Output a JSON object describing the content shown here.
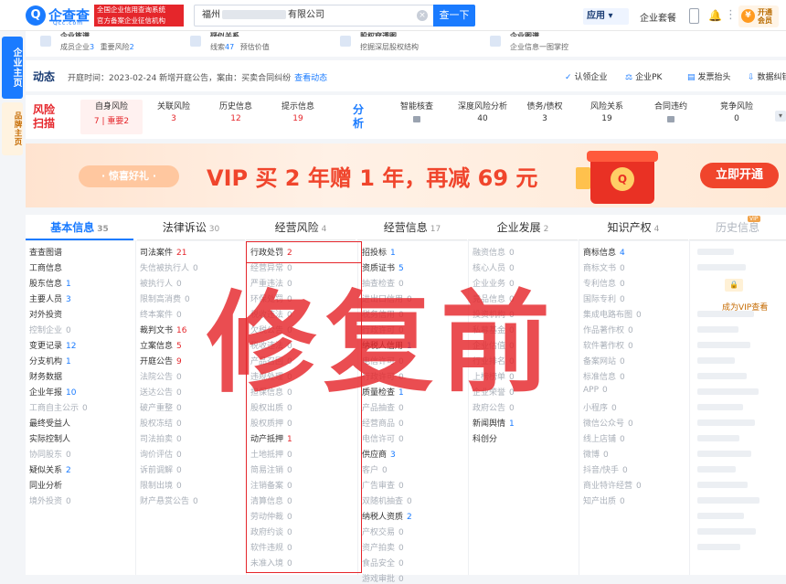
{
  "header": {
    "logo_icon": "Q",
    "logo_text": "企查查",
    "logo_sub": "Qcc.com",
    "tag_line1": "全国企业信用查询系统",
    "tag_line2": "官方备案企业征信机构",
    "search_prefix": "福州",
    "search_suffix": "有限公司",
    "search_button": "查一下",
    "app_label": "应用 ▾",
    "enterprise_link": "企业套餐",
    "vip_badge": "¥",
    "vip_line1": "开通",
    "vip_line2": "会员"
  },
  "sidebar": {
    "enterprise_home": "企业主页",
    "brand_home": "品牌主页"
  },
  "summary_cards": [
    {
      "title": "企业族谱",
      "sub_label1": "成员企业",
      "sub_value1": "3",
      "sub_label2": "重要风险",
      "sub_value2": "2"
    },
    {
      "title": "疑似关系",
      "sub_label1": "线索",
      "sub_value1": "47",
      "sub_label2": "预估价值",
      "sub_value2": ""
    },
    {
      "title": "股权穿透图",
      "sub_label1": "挖掘深层股权结构",
      "sub_value1": "",
      "sub_label2": "",
      "sub_value2": ""
    },
    {
      "title": "企业图谱",
      "sub_label1": "企业信息一图掌控",
      "sub_value1": "",
      "sub_label2": "",
      "sub_value2": ""
    }
  ],
  "dynamics": {
    "title": "动态",
    "text": "开庭时间：2023-02-24 新增开庭公告，案由：买卖合同纠纷",
    "link": "查看动态",
    "actions": [
      {
        "icon": "✓",
        "label": "认领企业"
      },
      {
        "icon": "⚖",
        "label": "企业PK"
      },
      {
        "icon": "▤",
        "label": "发票抬头"
      },
      {
        "icon": "⇩",
        "label": "数据纠错"
      }
    ]
  },
  "risk": {
    "label_line1": "风险",
    "label_line2": "扫描",
    "items": [
      {
        "title": "自身风险",
        "count": "7",
        "important_label": "重要2"
      },
      {
        "title": "关联风险",
        "count": "3"
      },
      {
        "title": "历史信息",
        "count": "12"
      },
      {
        "title": "提示信息",
        "count": "19"
      }
    ]
  },
  "analysis": {
    "label_line1": "分",
    "label_line2": "析",
    "items": [
      {
        "title": "智能核查",
        "count": ""
      },
      {
        "title": "深度风险分析",
        "count": "40"
      },
      {
        "title": "债务/债权",
        "count": "3"
      },
      {
        "title": "风险关系",
        "count": "19"
      },
      {
        "title": "合同违约",
        "count": ""
      },
      {
        "title": "竞争风险",
        "count": "0"
      }
    ],
    "expand": "▾"
  },
  "banner": {
    "tag": "· 惊喜好礼 ·",
    "text": "VIP 买 2 年赠 1 年，再减 69 元",
    "coin": "Q",
    "button": "立即开通"
  },
  "tabs": [
    {
      "label": "基本信息",
      "count": "35"
    },
    {
      "label": "法律诉讼",
      "count": "30"
    },
    {
      "label": "经营风险",
      "count": "4"
    },
    {
      "label": "经营信息",
      "count": "17"
    },
    {
      "label": "企业发展",
      "count": "2"
    },
    {
      "label": "知识产权",
      "count": "4"
    },
    {
      "label": "历史信息",
      "count": ""
    }
  ],
  "vip_mini": "VIP",
  "columns": {
    "basic": [
      {
        "label": "查查图谱",
        "value": ""
      },
      {
        "label": "工商信息",
        "value": ""
      },
      {
        "label": "股东信息",
        "value": "1"
      },
      {
        "label": "主要人员",
        "value": "3"
      },
      {
        "label": "对外投资",
        "value": ""
      },
      {
        "label": "控制企业",
        "value": "0"
      },
      {
        "label": "变更记录",
        "value": "12"
      },
      {
        "label": "分支机构",
        "value": "1"
      },
      {
        "label": "财务数据",
        "value": ""
      },
      {
        "label": "企业年报",
        "value": "10"
      },
      {
        "label": "工商自主公示",
        "value": "0"
      },
      {
        "label": "最终受益人",
        "value": ""
      },
      {
        "label": "实际控制人",
        "value": ""
      },
      {
        "label": "协同股东",
        "value": "0"
      },
      {
        "label": "疑似关系",
        "value": "2"
      },
      {
        "label": "同业分析",
        "value": ""
      },
      {
        "label": "境外投资",
        "value": "0"
      }
    ],
    "legal": [
      {
        "label": "司法案件",
        "value": "21"
      },
      {
        "label": "失信被执行人",
        "value": "0"
      },
      {
        "label": "被执行人",
        "value": "0"
      },
      {
        "label": "限制高消费",
        "value": "0"
      },
      {
        "label": "终本案件",
        "value": "0"
      },
      {
        "label": "裁判文书",
        "value": "16"
      },
      {
        "label": "立案信息",
        "value": "5"
      },
      {
        "label": "开庭公告",
        "value": "9"
      },
      {
        "label": "法院公告",
        "value": "0"
      },
      {
        "label": "送达公告",
        "value": "0"
      },
      {
        "label": "破产重整",
        "value": "0"
      },
      {
        "label": "股权冻结",
        "value": "0"
      },
      {
        "label": "司法拍卖",
        "value": "0"
      },
      {
        "label": "询价评估",
        "value": "0"
      },
      {
        "label": "诉前调解",
        "value": "0"
      },
      {
        "label": "限制出境",
        "value": "0"
      },
      {
        "label": "财产悬赏公告",
        "value": "0"
      }
    ],
    "risk": [
      {
        "label": "行政处罚",
        "value": "2"
      },
      {
        "label": "经营异常",
        "value": "0"
      },
      {
        "label": "严重违法",
        "value": "0"
      },
      {
        "label": "环保处罚",
        "value": "0"
      },
      {
        "label": "税收违法",
        "value": "0"
      },
      {
        "label": "欠税公告",
        "value": "0"
      },
      {
        "label": "税收违法",
        "value": "0"
      },
      {
        "label": "产品召回",
        "value": "0"
      },
      {
        "label": "违规处理",
        "value": "0"
      },
      {
        "label": "担保信息",
        "value": "0"
      },
      {
        "label": "股权出质",
        "value": "0"
      },
      {
        "label": "股权质押",
        "value": "0"
      },
      {
        "label": "动产抵押",
        "value": "1"
      },
      {
        "label": "土地抵押",
        "value": "0"
      },
      {
        "label": "简易注销",
        "value": "0"
      },
      {
        "label": "注销备案",
        "value": "0"
      },
      {
        "label": "清算信息",
        "value": "0"
      },
      {
        "label": "劳动仲裁",
        "value": "0"
      },
      {
        "label": "政府约谈",
        "value": "0"
      },
      {
        "label": "软件违规",
        "value": "0"
      },
      {
        "label": "未准入境",
        "value": "0"
      }
    ],
    "operation": [
      {
        "label": "招投标",
        "value": "1"
      },
      {
        "label": "资质证书",
        "value": "5"
      },
      {
        "label": "抽查检查",
        "value": "0"
      },
      {
        "label": "进出口信用",
        "value": "0"
      },
      {
        "label": "税务信用",
        "value": "0"
      },
      {
        "label": "行政许可",
        "value": "0"
      },
      {
        "label": "纳税人信用",
        "value": "1"
      },
      {
        "label": "电信许可",
        "value": "0"
      },
      {
        "label": "行政许可",
        "value": "0"
      },
      {
        "label": "质量检查",
        "value": "1"
      },
      {
        "label": "产品抽查",
        "value": "0"
      },
      {
        "label": "经营商品",
        "value": "0"
      },
      {
        "label": "电信许可",
        "value": "0"
      },
      {
        "label": "供应商",
        "value": "3"
      },
      {
        "label": "客户",
        "value": "0"
      },
      {
        "label": "广告审查",
        "value": "0"
      },
      {
        "label": "双随机抽查",
        "value": "0"
      },
      {
        "label": "纳税人资质",
        "value": "2"
      },
      {
        "label": "产权交易",
        "value": "0"
      },
      {
        "label": "资产拍卖",
        "value": "0"
      },
      {
        "label": "食品安全",
        "value": "0"
      },
      {
        "label": "游戏审批",
        "value": "0"
      }
    ],
    "development": [
      {
        "label": "融资信息",
        "value": "0"
      },
      {
        "label": "核心人员",
        "value": "0"
      },
      {
        "label": "企业业务",
        "value": "0"
      },
      {
        "label": "竞品信息",
        "value": "0"
      },
      {
        "label": "投资机构",
        "value": "0"
      },
      {
        "label": "私募基金",
        "value": "0"
      },
      {
        "label": "企业估值",
        "value": "0"
      },
      {
        "label": "行业排名",
        "value": "0"
      },
      {
        "label": "上榜榜单",
        "value": "0"
      },
      {
        "label": "企业荣誉",
        "value": "0"
      },
      {
        "label": "政府公告",
        "value": "0"
      },
      {
        "label": "新闻舆情",
        "value": "1"
      },
      {
        "label": "科创分",
        "value": ""
      }
    ],
    "ip": [
      {
        "label": "商标信息",
        "value": "4"
      },
      {
        "label": "商标文书",
        "value": "0"
      },
      {
        "label": "专利信息",
        "value": "0"
      },
      {
        "label": "国际专利",
        "value": "0"
      },
      {
        "label": "集成电路布图",
        "value": "0"
      },
      {
        "label": "作品著作权",
        "value": "0"
      },
      {
        "label": "软件著作权",
        "value": "0"
      },
      {
        "label": "备案网站",
        "value": "0"
      },
      {
        "label": "标准信息",
        "value": "0"
      },
      {
        "label": "APP",
        "value": "0"
      },
      {
        "label": "小程序",
        "value": "0"
      },
      {
        "label": "微信公众号",
        "value": "0"
      },
      {
        "label": "线上店铺",
        "value": "0"
      },
      {
        "label": "微博",
        "value": "0"
      },
      {
        "label": "抖音/快手",
        "value": "0"
      },
      {
        "label": "商业特许经营",
        "value": "0"
      },
      {
        "label": "知产出质",
        "value": "0"
      }
    ]
  },
  "history_vip": {
    "lock_icon": "🔒",
    "cta": "成为VIP查看"
  },
  "watermark": "修复前"
}
